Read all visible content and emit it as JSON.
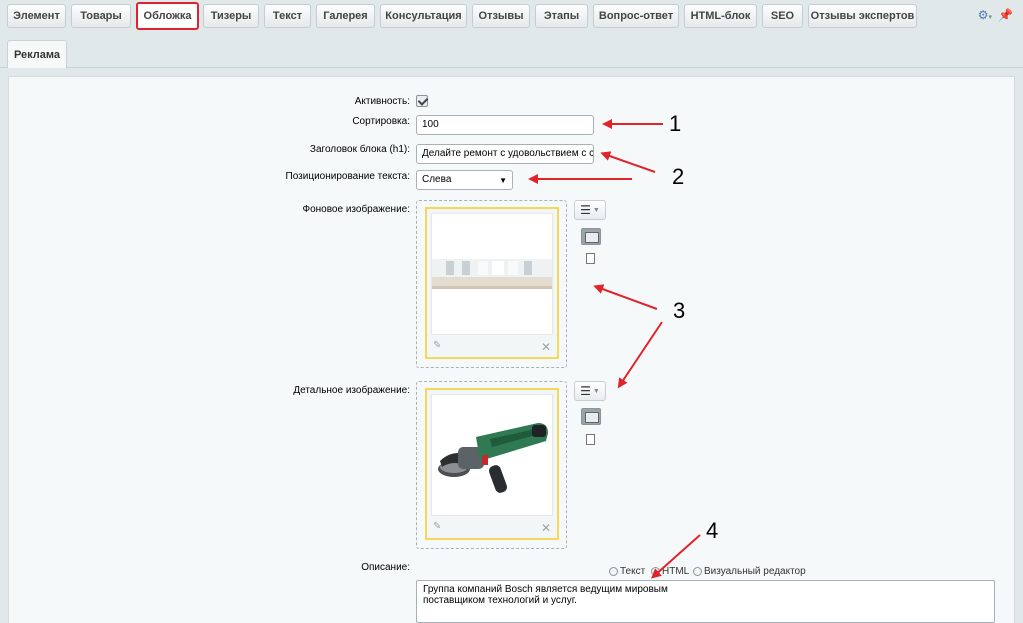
{
  "tabs": [
    {
      "label": "Элемент"
    },
    {
      "label": "Товары"
    },
    {
      "label": "Обложка"
    },
    {
      "label": "Тизеры"
    },
    {
      "label": "Текст"
    },
    {
      "label": "Галерея"
    },
    {
      "label": "Консультация"
    },
    {
      "label": "Отзывы"
    },
    {
      "label": "Этапы"
    },
    {
      "label": "Вопрос-ответ"
    },
    {
      "label": "HTML-блок"
    },
    {
      "label": "SEO"
    },
    {
      "label": "Отзывы экспертов"
    }
  ],
  "active_tab": "Обложка",
  "subtabs": [
    {
      "label": "Реклама"
    }
  ],
  "form": {
    "active_label": "Активность:",
    "active_checked": true,
    "sort_label": "Сортировка:",
    "sort_value": "100",
    "heading_label": "Заголовок блока (h1):",
    "heading_value": "Делайте ремонт с удовольствием  с сов",
    "position_label": "Позиционирование текста:",
    "position_value": "Слева",
    "bg_image_label": "Фоновое изображение:",
    "detail_image_label": "Детальное изображение:",
    "description_label": "Описание:",
    "editor_modes": [
      "Текст",
      "HTML",
      "Визуальный редактор"
    ],
    "editor_mode_selected": "HTML",
    "description_line1": "Группа компаний Bosch является ведущим мировым",
    "description_line2": "поставщиком технологий и услуг."
  },
  "annotations": [
    "1",
    "2",
    "3",
    "4"
  ],
  "colors": {
    "highlight": "#e0242b",
    "arrow": "#e0242b",
    "image_frame": "#f2d95c",
    "tool_green": "#2f7a52"
  },
  "icons": [
    "gear-icon",
    "pin-icon",
    "checkbox-icon",
    "pencil-icon",
    "close-icon",
    "menu-icon",
    "image-icon",
    "file-icon"
  ]
}
